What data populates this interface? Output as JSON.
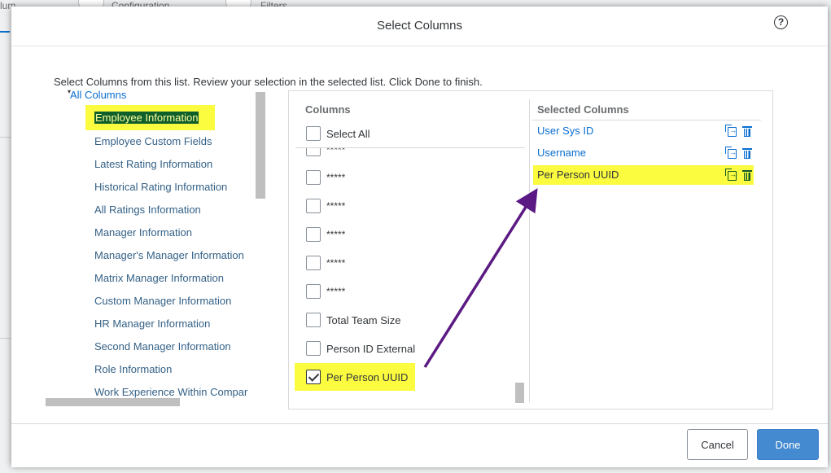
{
  "background": {
    "tabs": [
      "lum",
      "Configuration",
      "Filters"
    ]
  },
  "dialog": {
    "title": "Select Columns",
    "help_icon": "?",
    "instructions": "Select Columns from this list. Review your selection in the selected list. Click Done to finish."
  },
  "tree": {
    "root": "All Columns",
    "items": [
      "Employee Information",
      "Employee Custom Fields",
      "Latest Rating Information",
      "Historical Rating Information",
      "All Ratings Information",
      "Manager Information",
      "Manager's Manager Information",
      "Matrix Manager Information",
      "Custom Manager Information",
      "HR Manager Information",
      "Second Manager Information",
      "Role Information",
      "Work Experience Within Compar"
    ]
  },
  "columns": {
    "header": "Columns",
    "select_all": "Select All",
    "items": [
      {
        "label": "*****",
        "checked": false
      },
      {
        "label": "*****",
        "checked": false
      },
      {
        "label": "*****",
        "checked": false
      },
      {
        "label": "*****",
        "checked": false
      },
      {
        "label": "*****",
        "checked": false
      },
      {
        "label": "*****",
        "checked": false
      },
      {
        "label": "Total Team Size",
        "checked": false
      },
      {
        "label": "Person ID External",
        "checked": false
      },
      {
        "label": "Per Person UUID",
        "checked": true
      }
    ]
  },
  "selected": {
    "header": "Selected Columns",
    "items": [
      "User Sys ID",
      "Username",
      "Per Person UUID"
    ]
  },
  "footer": {
    "cancel": "Cancel",
    "done": "Done"
  },
  "colors": {
    "highlight": "#fbfb3f",
    "link": "#0a6ed1",
    "primary_button": "#448ad0",
    "arrow": "#5b1a83"
  }
}
